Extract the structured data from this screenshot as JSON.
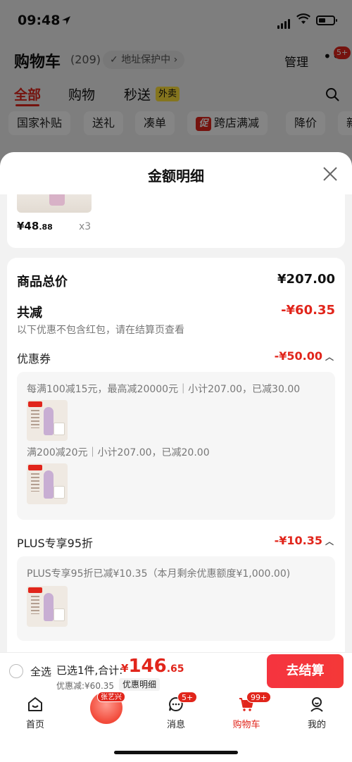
{
  "status_bar": {
    "time": "09:48"
  },
  "cart": {
    "title": "购物车",
    "count": "(209)",
    "address_protect": "地址保护中 ›",
    "manage": "管理",
    "more_badge": "5+",
    "tabs": [
      "全部",
      "购物",
      "秒送"
    ],
    "waimai_tag": "外卖",
    "chips": [
      "国家补贴",
      "送礼",
      "凑单",
      "跨店满减",
      "降价",
      "新"
    ],
    "promo_mark": "促"
  },
  "sheet": {
    "title": "金额明细",
    "product": {
      "price_main": "¥48",
      "price_dec": ".88",
      "qty": "x3"
    },
    "goods_total_label": "商品总价",
    "goods_total_value": "¥207.00",
    "total_reduce_label": "共减",
    "total_reduce_value": "-¥60.35",
    "note": "以下优惠不包含红包，请在结算页查看",
    "coupon": {
      "label": "优惠券",
      "value": "-¥50.00",
      "rule1": "每满100减15元，最高减20000元｜小计207.00，已减30.00",
      "rule2": "满200减20元｜小计207.00，已减20.00"
    },
    "plus": {
      "label": "PLUS专享95折",
      "value": "-¥10.35",
      "rule": "PLUS专享95折已减¥10.35（本月剩余优惠额度¥1,000.00)"
    }
  },
  "checkout": {
    "select_all": "全选",
    "selected_total": "已选1件,合计:",
    "currency": "¥",
    "total_int": "146",
    "total_dec": ".65",
    "discount_line": "优惠减:¥60.35",
    "detail_tag": "优惠明细",
    "button": "去结算"
  },
  "tabbar": {
    "items": [
      "首页",
      "消息",
      "购物车",
      "我的"
    ],
    "center_tag": "张艺兴",
    "message_badge": "5+",
    "cart_badge": "99+"
  },
  "colors": {
    "accent": "#e1251b",
    "button": "#f5343f"
  },
  "icons": [
    "location-arrow-icon",
    "signal-icon",
    "wifi-icon",
    "battery-icon",
    "shield-icon",
    "more-icon",
    "search-icon",
    "close-icon",
    "radio-icon",
    "home-icon",
    "message-icon",
    "cart-icon",
    "profile-icon"
  ]
}
